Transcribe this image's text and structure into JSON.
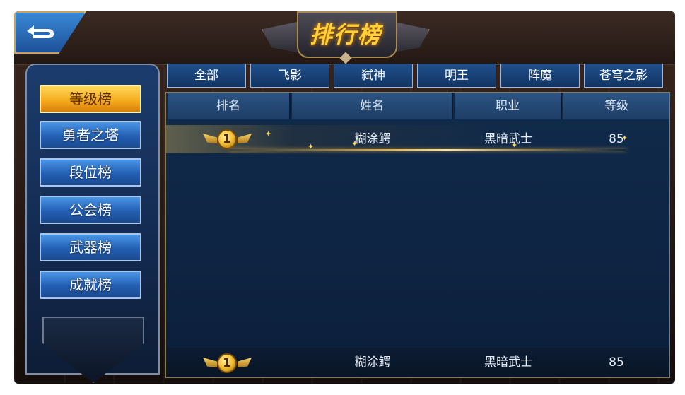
{
  "title": "排行榜",
  "back_button": "back-arrow-icon",
  "categories": [
    {
      "label": "等级榜",
      "active": true
    },
    {
      "label": "勇者之塔",
      "active": false
    },
    {
      "label": "段位榜",
      "active": false
    },
    {
      "label": "公会榜",
      "active": false
    },
    {
      "label": "武器榜",
      "active": false
    },
    {
      "label": "成就榜",
      "active": false
    }
  ],
  "tabs": [
    "全部",
    "飞影",
    "弑神",
    "明王",
    "阵魔",
    "苍穹之影"
  ],
  "table": {
    "headers": [
      "排名",
      "姓名",
      "职业",
      "等级"
    ],
    "rows": [
      {
        "rank": "1",
        "name": "糊涂鳄",
        "class": "黑暗武士",
        "level": "85"
      }
    ],
    "my_rank": {
      "rank": "1",
      "name": "糊涂鳄",
      "class": "黑暗武士",
      "level": "85"
    }
  },
  "colors": {
    "active_tab_gold": "#f4a91a",
    "button_blue": "#235fb3",
    "panel_navy": "#0c1f3b",
    "title_gold": "#ffd23a"
  }
}
